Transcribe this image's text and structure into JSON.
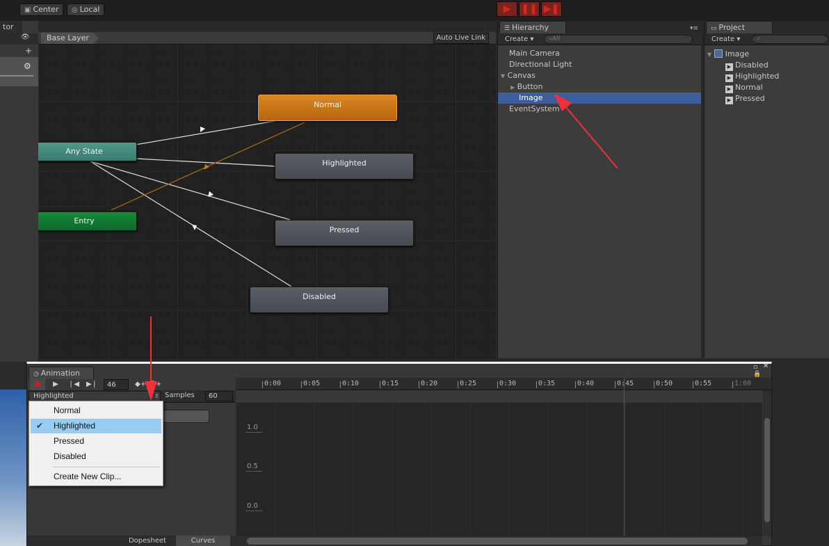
{
  "toolbar": {
    "pivot_label": "Center",
    "space_label": "Local",
    "left_tab_label": "tor"
  },
  "animator": {
    "breadcrumb": "Base Layer",
    "auto_live_link": "Auto Live Link",
    "states": {
      "normal": "Normal",
      "highlighted": "Highlighted",
      "pressed": "Pressed",
      "disabled": "Disabled",
      "any_state": "Any State",
      "entry": "Entry"
    }
  },
  "hierarchy": {
    "tab_label": "Hierarchy",
    "create_label": "Create ▾",
    "search_placeholder": "All",
    "items": [
      "Main Camera",
      "Directional Light",
      "Canvas",
      "Button",
      "Image",
      "EventSystem"
    ]
  },
  "project": {
    "tab_label": "Project",
    "create_label": "Create ▾",
    "root": "Image",
    "clips": [
      "Disabled",
      "Highlighted",
      "Normal",
      "Pressed"
    ]
  },
  "animation": {
    "tab_label": "Animation",
    "frame_value": "46",
    "current_clip": "Highlighted",
    "samples_label": "Samples",
    "samples_value": "60",
    "ticks": [
      "0:00",
      "0:05",
      "0:10",
      "0:15",
      "0:20",
      "0:25",
      "0:30",
      "0:35",
      "0:40",
      "0:45",
      "0:50",
      "0:55",
      "1:00"
    ],
    "y_labels": [
      "1.0",
      "0.5",
      "0.0"
    ],
    "dopesheet_tab": "Dopesheet",
    "curves_tab": "Curves"
  },
  "clip_menu": {
    "items": [
      "Normal",
      "Highlighted",
      "Pressed",
      "Disabled"
    ],
    "selected": "Highlighted",
    "create_new": "Create New Clip..."
  },
  "colors": {
    "selection": "#3e5e9a",
    "playhead": "#e02020",
    "annotation_arrow": "#f0303a"
  }
}
